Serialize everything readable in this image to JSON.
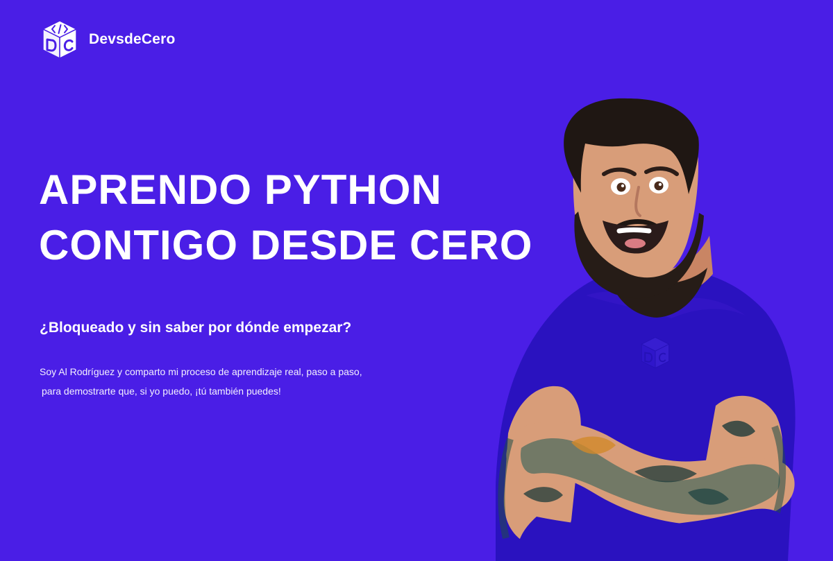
{
  "header": {
    "logo_icon": "dc-cube-logo",
    "brand_name": "DevsdeCero"
  },
  "hero": {
    "title_line_1": "APRENDO PYTHON",
    "title_line_2": "CONTIGO DESDE CERO",
    "subheading": "¿Bloqueado y sin saber por dónde empezar?",
    "body_line_1": "Soy Al Rodríguez y comparto mi proceso de aprendizaje real, paso a paso,",
    "body_line_2": "para demostrarte que, si  yo puedo, ¡tú también puedes!"
  },
  "portrait": {
    "subject": "person-with-crossed-arms",
    "shirt_icon": "dc-cube-logo"
  },
  "colors": {
    "background": "#4a1ee6",
    "text": "#ffffff",
    "shirt": "#2614b8",
    "skin": "#d99b78",
    "hair": "#1f1713"
  }
}
